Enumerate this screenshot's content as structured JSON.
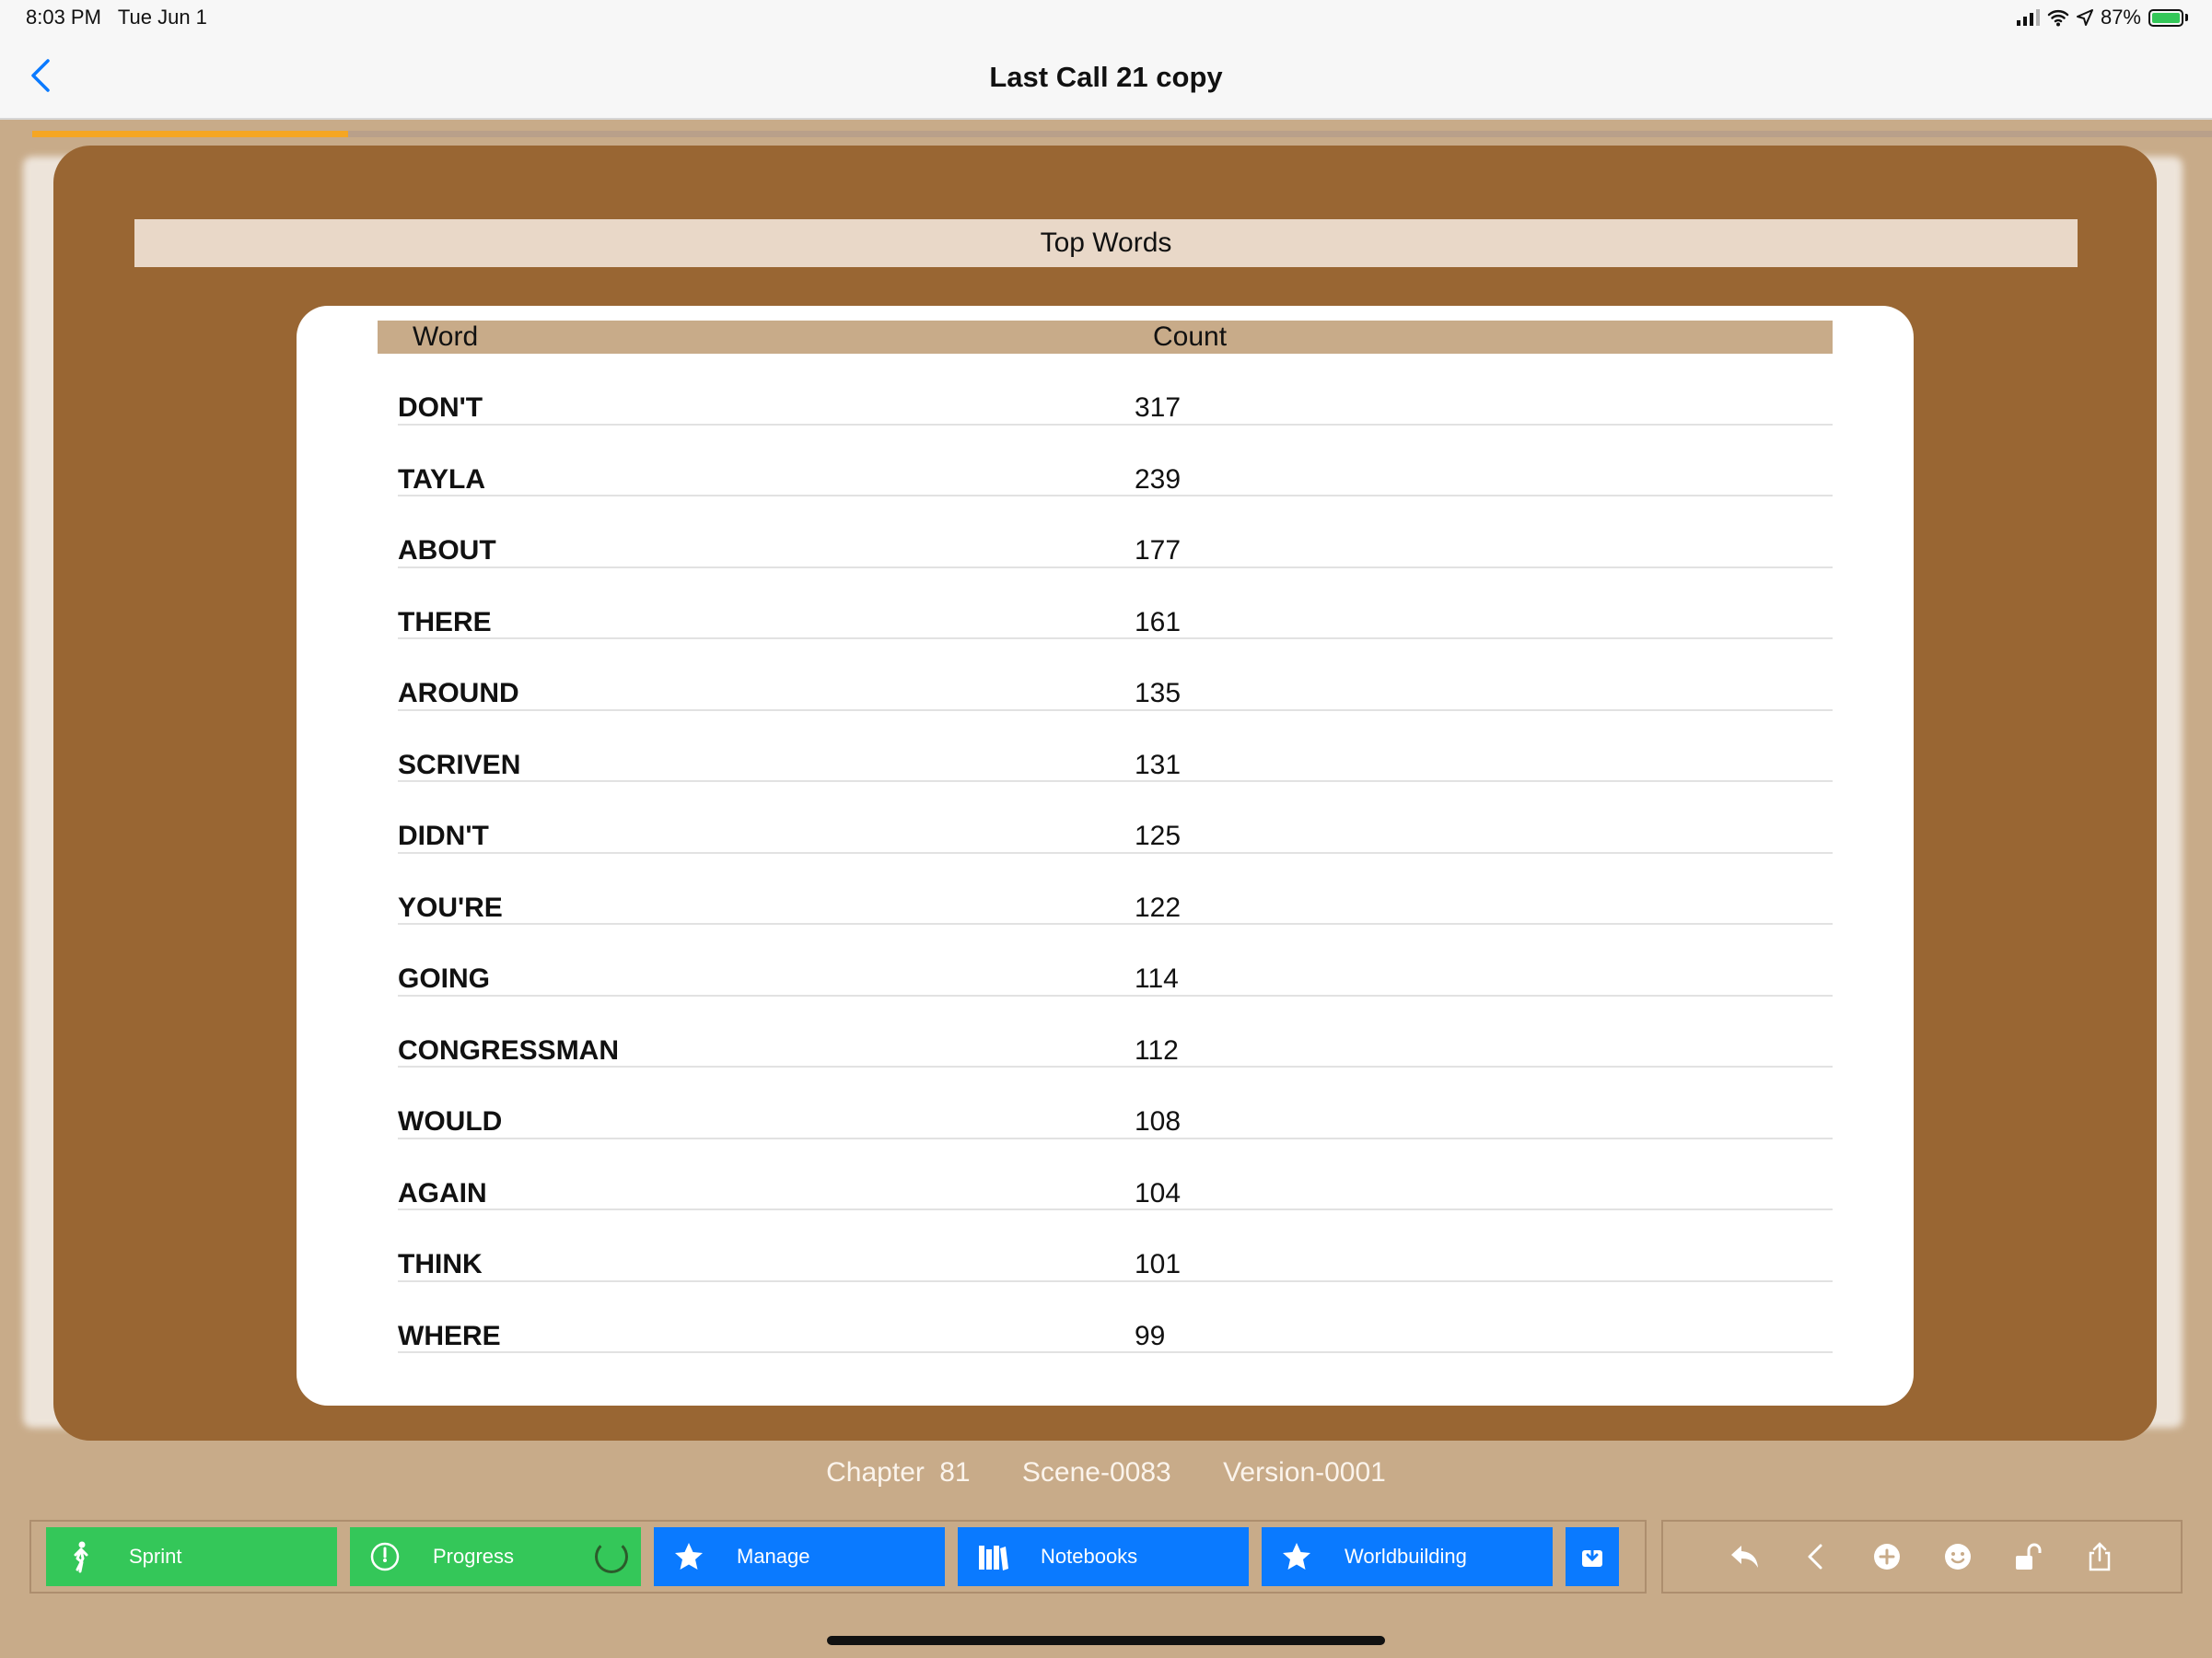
{
  "status": {
    "time": "8:03 PM",
    "date": "Tue Jun 1",
    "battery": "87%"
  },
  "nav": {
    "title": "Last Call 21 copy"
  },
  "progress": {
    "fraction": 0.145,
    "color": "#f5a623"
  },
  "modal": {
    "title": "Top Words",
    "columns": {
      "word": "Word",
      "count": "Count"
    },
    "rows": [
      {
        "word": "DON'T",
        "count": "317"
      },
      {
        "word": "TAYLA",
        "count": "239"
      },
      {
        "word": "ABOUT",
        "count": "177"
      },
      {
        "word": "THERE",
        "count": "161"
      },
      {
        "word": "AROUND",
        "count": "135"
      },
      {
        "word": "SCRIVEN",
        "count": "131"
      },
      {
        "word": "DIDN'T",
        "count": "125"
      },
      {
        "word": "YOU'RE",
        "count": "122"
      },
      {
        "word": "GOING",
        "count": "114"
      },
      {
        "word": "CONGRESSMAN",
        "count": "112"
      },
      {
        "word": "WOULD",
        "count": "108"
      },
      {
        "word": "AGAIN",
        "count": "104"
      },
      {
        "word": "THINK",
        "count": "101"
      },
      {
        "word": "WHERE",
        "count": "99"
      }
    ]
  },
  "meta": {
    "chapter": "Chapter 81",
    "scene": "Scene-0083",
    "version": "Version-0001"
  },
  "toolbar": {
    "sprint": "Sprint",
    "progress": "Progress",
    "manage": "Manage",
    "notebooks": "Notebooks",
    "worldbuilding": "Worldbuilding"
  },
  "icons": [
    "walking-figure-icon",
    "gauge-icon",
    "star-icon",
    "books-icon",
    "download-icon",
    "reply-icon",
    "chevron-left-icon",
    "plus-circle-icon",
    "smiley-icon",
    "unlock-icon",
    "share-icon"
  ],
  "colors": {
    "background": "#c8ab89",
    "modal": "#996633",
    "green": "#34c759",
    "blue": "#0a7aff"
  }
}
